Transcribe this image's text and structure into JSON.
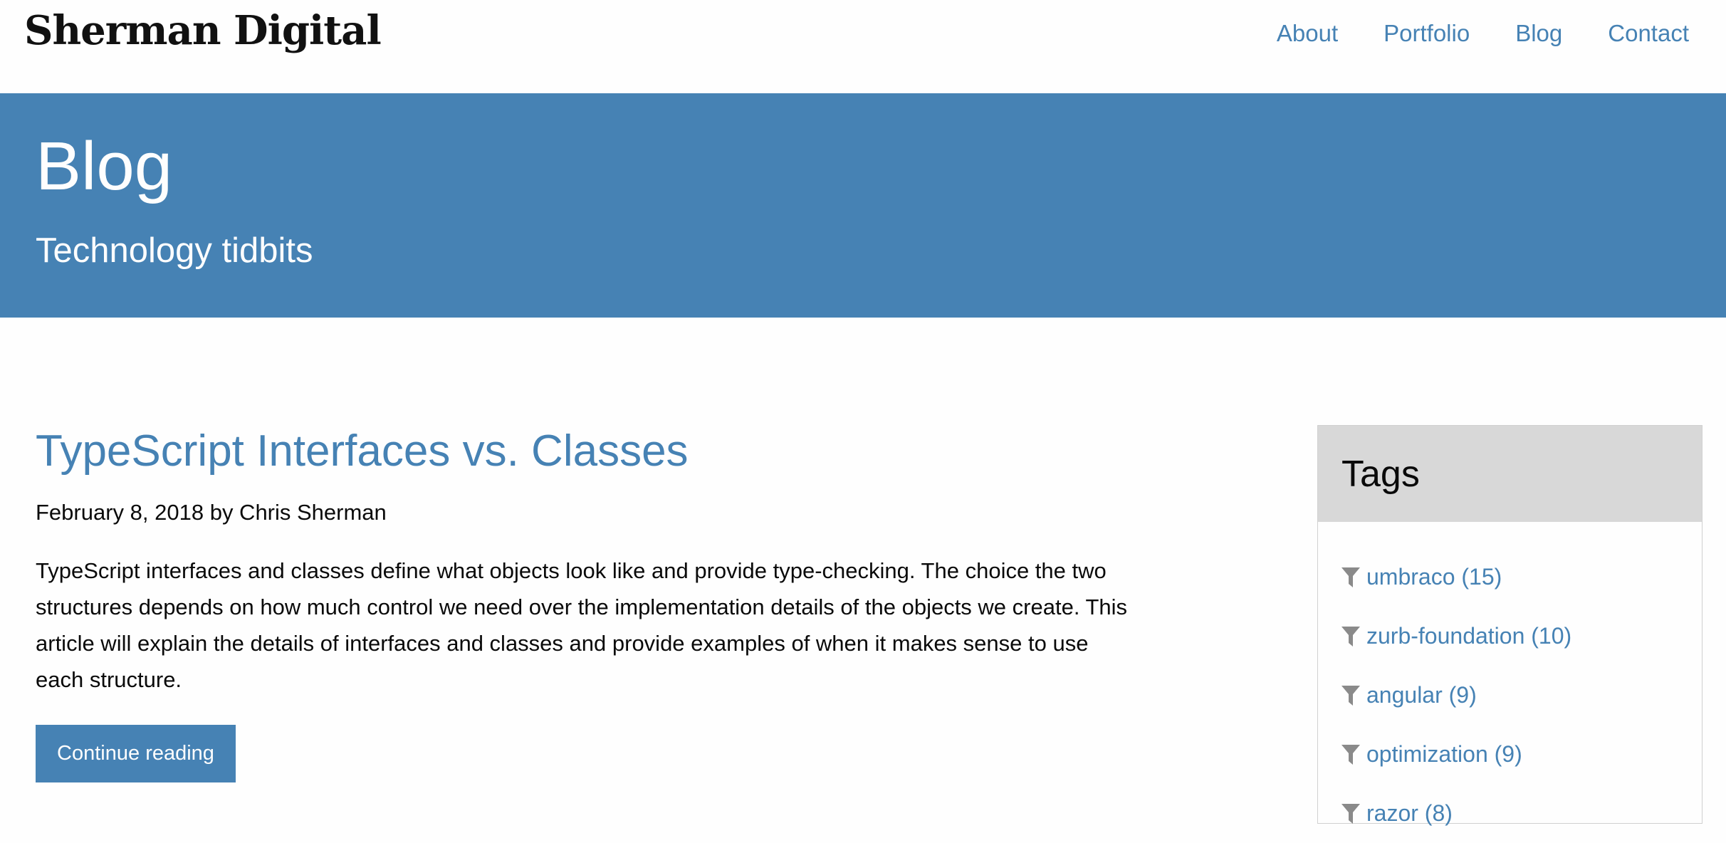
{
  "site": {
    "logo": "Sherman Digital"
  },
  "nav": {
    "items": [
      {
        "label": "About"
      },
      {
        "label": "Portfolio"
      },
      {
        "label": "Blog"
      },
      {
        "label": "Contact"
      }
    ]
  },
  "hero": {
    "title": "Blog",
    "subtitle": "Technology tidbits"
  },
  "post": {
    "title": "TypeScript Interfaces vs. Classes",
    "meta": "February 8, 2018 by Chris Sherman",
    "excerpt": "TypeScript interfaces and classes define what objects look like and provide type-checking. The choice the two structures depends on how much control we need over the implementation details of the objects we create. This article will explain the details of interfaces and classes and provide examples of when it makes sense to use each structure.",
    "button_label": "Continue reading"
  },
  "tags": {
    "heading": "Tags",
    "icon": "filter-icon",
    "items": [
      {
        "label": "umbraco (15)"
      },
      {
        "label": "zurb-foundation (10)"
      },
      {
        "label": "angular (9)"
      },
      {
        "label": "optimization (9)"
      },
      {
        "label": "razor (8)"
      }
    ]
  },
  "colors": {
    "accent": "#4682b4",
    "tag_header_bg": "#d8d8d8"
  }
}
